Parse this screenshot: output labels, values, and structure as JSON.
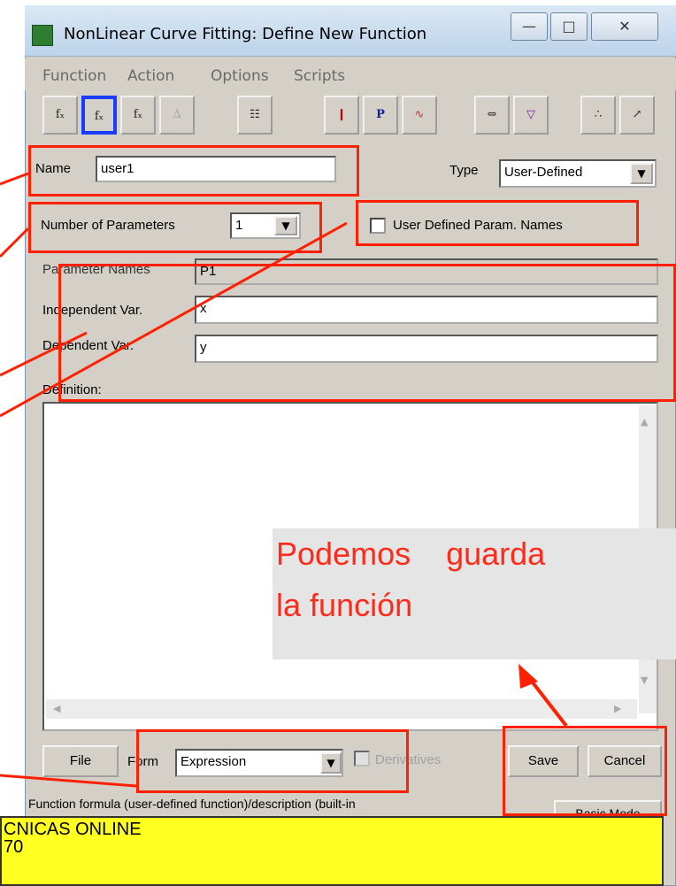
{
  "window": {
    "title": "NonLinear Curve Fitting:  Define New Function",
    "controls": {
      "minimize": "—",
      "maximize": "□",
      "close": "✕"
    }
  },
  "menubar": [
    "Function",
    "Action",
    "Options",
    "Scripts"
  ],
  "toolbar": [
    {
      "name": "f(x)-check-icon",
      "glyph": "fₓ"
    },
    {
      "name": "f(x)-edit-icon",
      "glyph": "fₓ"
    },
    {
      "name": "f(x)-window-icon",
      "glyph": "fₓ"
    },
    {
      "name": "peaks-icon",
      "glyph": "∆"
    },
    {
      "name": "worksheet-icon",
      "glyph": "☷"
    },
    {
      "name": "traffic-light-icon",
      "glyph": "❙"
    },
    {
      "name": "parameters-icon",
      "glyph": "P"
    },
    {
      "name": "curve-icon",
      "glyph": "∿"
    },
    {
      "name": "fit-width-icon",
      "glyph": "⇔"
    },
    {
      "name": "filter-p-icon",
      "glyph": "▽"
    },
    {
      "name": "scatter-icon",
      "glyph": "∴"
    },
    {
      "name": "scatter-arrow-icon",
      "glyph": "↗"
    }
  ],
  "form": {
    "name_label": "Name",
    "name_value": "user1",
    "type_label": "Type",
    "type_value": "User-Defined",
    "num_params_label": "Number of Parameters",
    "num_params_value": "1",
    "user_param_names_label": "User Defined Param. Names",
    "param_names_label": "Parameter Names",
    "param_names_value": "P1",
    "indep_label": "Independent Var.",
    "indep_value": "x",
    "dep_label": "Dependent Var.",
    "dep_value": "y",
    "definition_label": "Definition:",
    "definition_value": ""
  },
  "bottom": {
    "file_label": "File",
    "form_label": "Form",
    "form_value": "Expression",
    "derivatives_label": "Derivatives",
    "save_label": "Save",
    "cancel_label": "Cancel",
    "status_text": "Function formula (user-defined function)/description (built-in",
    "basic_mode_label": "Basic Mode"
  },
  "callout": {
    "line1": "Podemos    guarda",
    "line2": "la función"
  },
  "banner": {
    "line1": "CNICAS ONLINE",
    "line2": "70"
  },
  "colors": {
    "annotation_red": "#ff2000",
    "highlight_blue": "#1a3cff",
    "banner_yellow": "#ffff22",
    "dialog_gray": "#d4d0c8"
  }
}
